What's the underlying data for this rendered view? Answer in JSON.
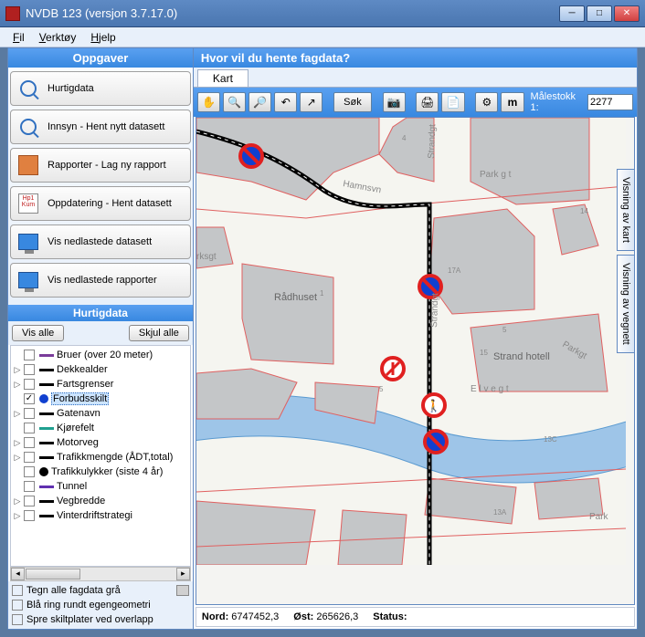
{
  "window": {
    "title": "NVDB 123 (versjon 3.7.17.0)"
  },
  "menu": {
    "file": "Fil",
    "tools": "Verktøy",
    "help": "Hjelp"
  },
  "left": {
    "header": "Oppgaver",
    "tasks": {
      "hurtigdata": "Hurtigdata",
      "innsyn": "Innsyn - Hent nytt datasett",
      "rapporter": "Rapporter - Lag ny rapport",
      "oppdatering": "Oppdatering - Hent datasett",
      "vis_datasett": "Vis nedlastede datasett",
      "vis_rapporter": "Vis nedlastede rapporter"
    },
    "hurtigdata_header": "Hurtigdata",
    "vis_alle": "Vis alle",
    "skjul_alle": "Skjul alle",
    "tree": [
      {
        "label": "Bruer (over 20 meter)",
        "exp": "",
        "checked": false,
        "symColor": "#7a3c9a",
        "symShape": "bar"
      },
      {
        "label": "Dekkealder",
        "exp": "▷",
        "checked": false,
        "symColor": "#000",
        "symShape": "bar"
      },
      {
        "label": "Fartsgrenser",
        "exp": "▷",
        "checked": false,
        "symColor": "#000",
        "symShape": "bar"
      },
      {
        "label": "Forbudsskilt",
        "exp": "",
        "checked": true,
        "symColor": "#1040d0",
        "symShape": "circle",
        "selected": true
      },
      {
        "label": "Gatenavn",
        "exp": "▷",
        "checked": false,
        "symColor": "#000",
        "symShape": "bar"
      },
      {
        "label": "Kjørefelt",
        "exp": "",
        "checked": false,
        "symColor": "#20a090",
        "symShape": "bar"
      },
      {
        "label": "Motorveg",
        "exp": "▷",
        "checked": false,
        "symColor": "#000",
        "symShape": "bar"
      },
      {
        "label": "Trafikkmengde (ÅDT,total)",
        "exp": "▷",
        "checked": false,
        "symColor": "#000",
        "symShape": "bar"
      },
      {
        "label": "Trafikkulykker (siste 4 år)",
        "exp": "",
        "checked": false,
        "symColor": "#000",
        "symShape": "circle"
      },
      {
        "label": "Tunnel",
        "exp": "",
        "checked": false,
        "symColor": "#6030b0",
        "symShape": "bar"
      },
      {
        "label": "Vegbredde",
        "exp": "▷",
        "checked": false,
        "symColor": "#000",
        "symShape": "bar"
      },
      {
        "label": "Vinterdriftstrategi",
        "exp": "▷",
        "checked": false,
        "symColor": "#000",
        "symShape": "bar"
      }
    ],
    "opts": {
      "gray": "Tegn alle fagdata grå",
      "ring": "Blå ring rundt egengeometri",
      "spre": "Spre skiltplater ved overlapp"
    }
  },
  "right": {
    "header": "Hvor vil du hente fagdata?",
    "tab_kart": "Kart",
    "sok": "Søk",
    "scale_label": "Målestokk  1:",
    "scale_value": "2277",
    "side_tab_kart": "Visning av kart",
    "side_tab_vegnett": "Visning av vegnett",
    "status": {
      "nord_lbl": "Nord:",
      "nord": "6747452,3",
      "ost_lbl": "Øst:",
      "ost": "265626,3",
      "status_lbl": "Status:"
    }
  },
  "map": {
    "streets": {
      "strandgt": "Strandgt",
      "strandgt2": "Strandgt",
      "parkgt": "Park g t",
      "parkgt2": "Parkgt",
      "parkgt3": "Park",
      "parksgt": "rksgt",
      "elvegt": "E l v e g t",
      "hamnsvn": "Hamnsvn"
    },
    "labels": {
      "radhuset": "Rådhuset",
      "strand_hotell": "Strand hotell"
    },
    "house_nums": {
      "n1": "1",
      "n4": "4",
      "n5": "5",
      "n14": "14",
      "n15": "15",
      "n5b": "5",
      "n17A": "17A",
      "n13A": "13A",
      "n13C": "13C"
    }
  }
}
